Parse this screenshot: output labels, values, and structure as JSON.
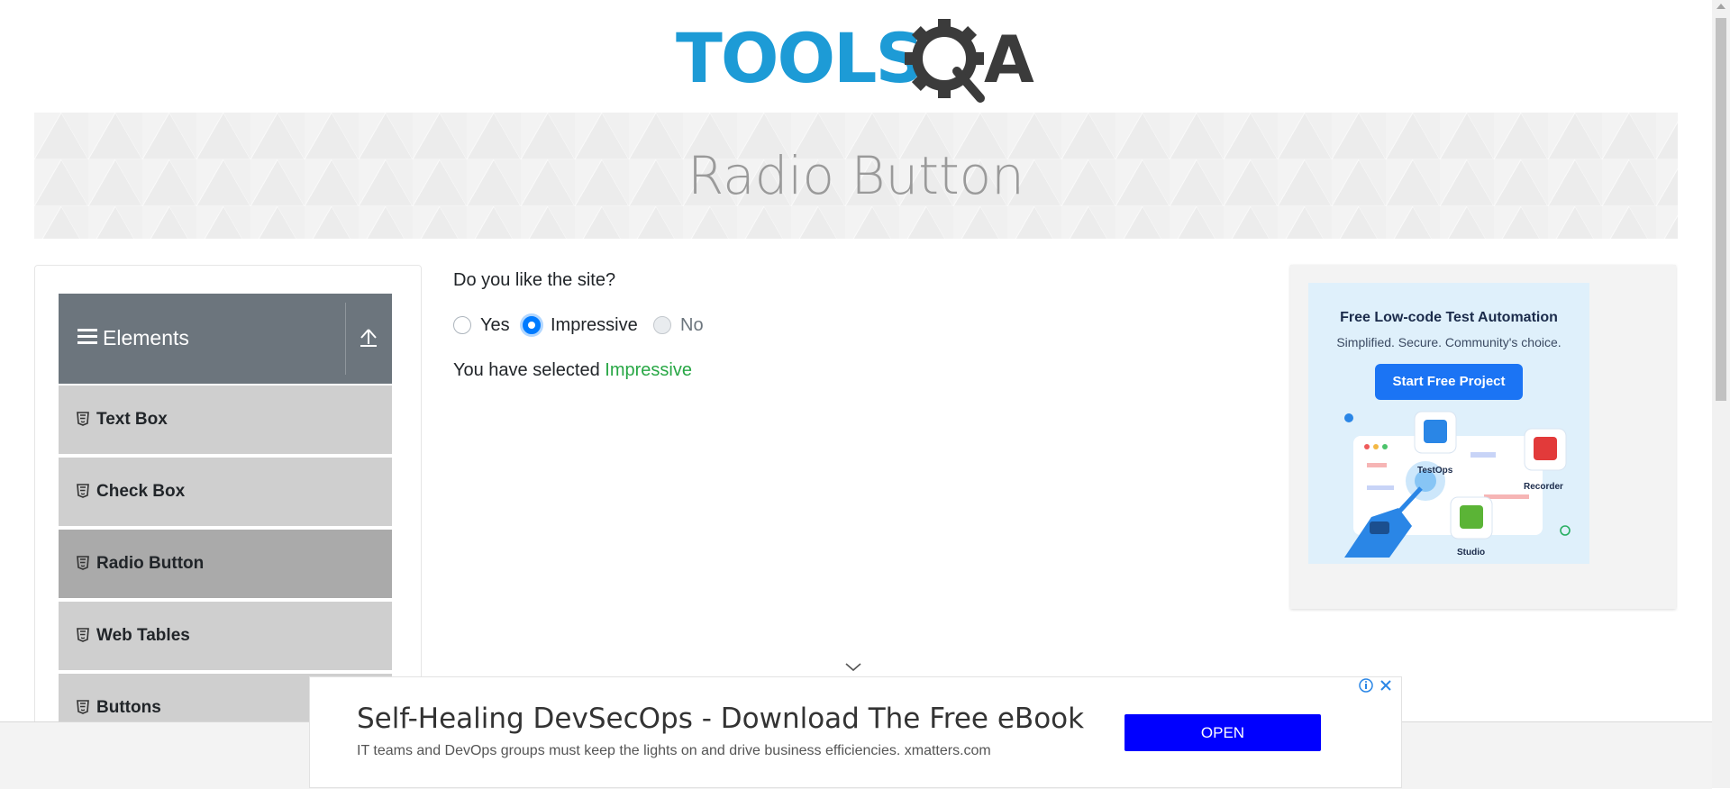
{
  "header": {
    "logo_alt": "TOOLSQA"
  },
  "banner": {
    "title": "Radio Button"
  },
  "sidebar": {
    "group_label": "Elements",
    "items": [
      {
        "label": "Text Box",
        "active": false
      },
      {
        "label": "Check Box",
        "active": false
      },
      {
        "label": "Radio Button",
        "active": true
      },
      {
        "label": "Web Tables",
        "active": false
      },
      {
        "label": "Buttons",
        "active": false
      }
    ]
  },
  "main": {
    "question": "Do you like the site?",
    "options": [
      {
        "label": "Yes",
        "checked": false,
        "disabled": false
      },
      {
        "label": "Impressive",
        "checked": true,
        "disabled": false
      },
      {
        "label": "No",
        "checked": false,
        "disabled": true
      }
    ],
    "result_prefix": "You have selected",
    "result_value": "Impressive"
  },
  "right_ad": {
    "headline": "Free Low-code Test Automation",
    "subline": "Simplified. Secure. Community's choice.",
    "cta": "Start Free Project",
    "product_labels": [
      "TestOps",
      "Recorder",
      "Studio"
    ]
  },
  "bottom_ad": {
    "headline": "Self-Healing DevSecOps - Download The Free eBook",
    "subline": "IT teams and DevOps groups must keep the lights on and drive business efficiencies. xmatters.com",
    "button": "OPEN"
  },
  "colors": {
    "accent": "#007bff",
    "success": "#28a745",
    "sidebar_header": "#6c757d",
    "ad_button": "#0000ff"
  }
}
